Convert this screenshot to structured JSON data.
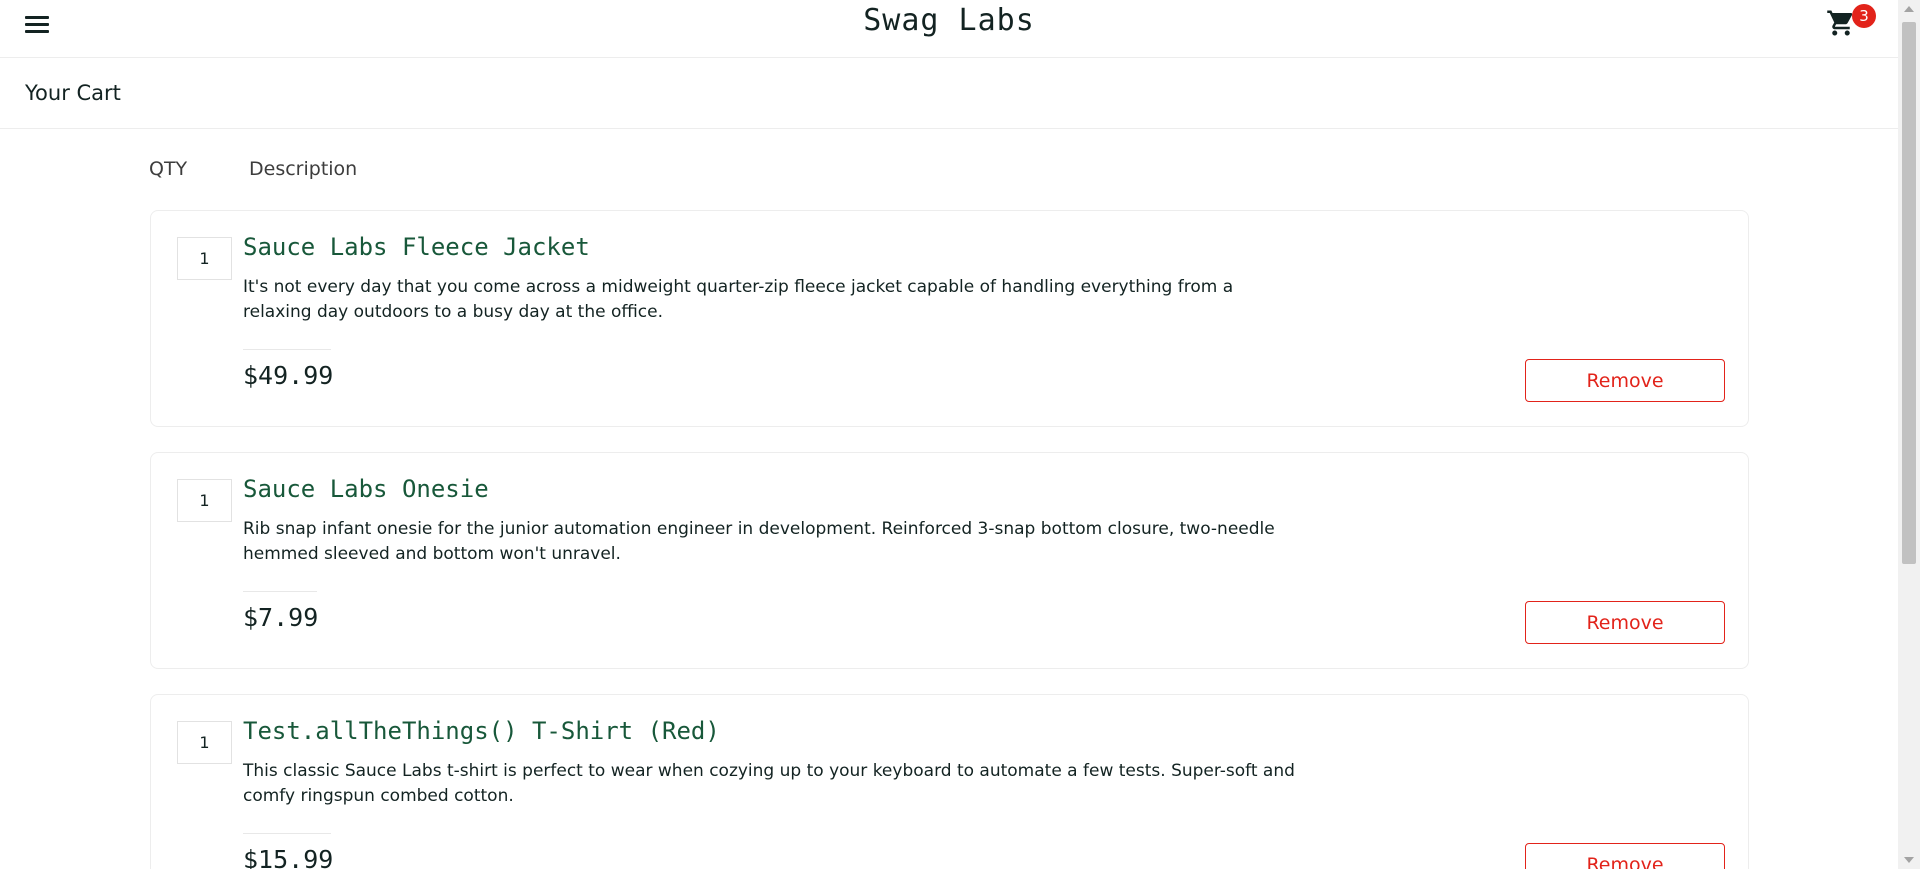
{
  "header": {
    "logo": "Swag Labs",
    "menu_icon": "hamburger-icon",
    "cart_icon": "shopping-cart-icon",
    "cart_count": "3"
  },
  "page": {
    "title": "Your Cart"
  },
  "columns": {
    "qty": "QTY",
    "description": "Description"
  },
  "cart_items": [
    {
      "qty": "1",
      "name": "Sauce Labs Fleece Jacket",
      "description": "It's not every day that you come across a midweight quarter-zip fleece jacket capable of handling everything from a relaxing day outdoors to a busy day at the office.",
      "price": "$49.99",
      "remove_label": "Remove"
    },
    {
      "qty": "1",
      "name": "Sauce Labs Onesie",
      "description": "Rib snap infant onesie for the junior automation engineer in development. Reinforced 3-snap bottom closure, two-needle hemmed sleeved and bottom won't unravel.",
      "price": "$7.99",
      "remove_label": "Remove"
    },
    {
      "qty": "1",
      "name": "Test.allTheThings() T-Shirt (Red)",
      "description": "This classic Sauce Labs t-shirt is perfect to wear when cozying up to your keyboard to automate a few tests. Super-soft and comfy ringspun combed cotton.",
      "price": "$15.99",
      "remove_label": "Remove"
    }
  ],
  "colors": {
    "brand_text": "#132322",
    "item_title": "#18583a",
    "danger": "#e2231a"
  }
}
